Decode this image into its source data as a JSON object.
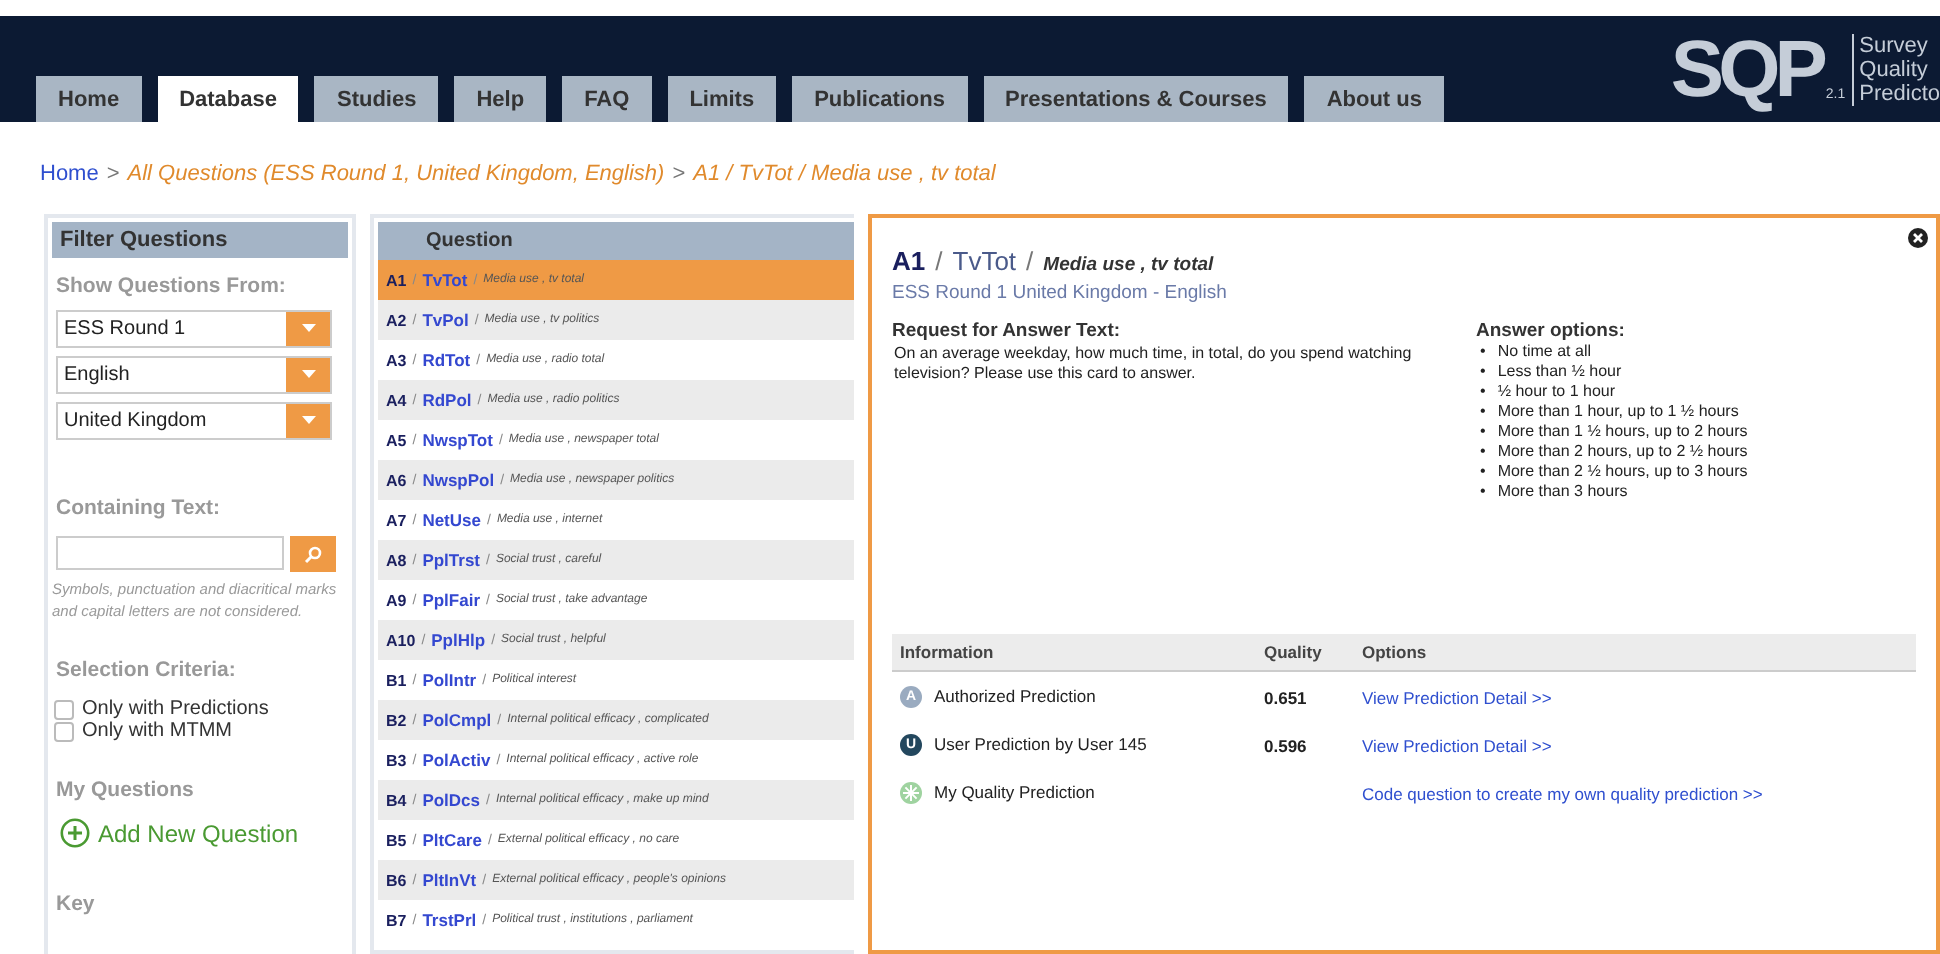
{
  "logo": {
    "mark": "SQP",
    "version": "2.1",
    "lines": [
      "Survey",
      "Quality",
      "Predicto"
    ]
  },
  "tabs": [
    {
      "label": "Home",
      "selected": false
    },
    {
      "label": "Database",
      "selected": true
    },
    {
      "label": "Studies",
      "selected": false
    },
    {
      "label": "Help",
      "selected": false
    },
    {
      "label": "FAQ",
      "selected": false
    },
    {
      "label": "Limits",
      "selected": false
    },
    {
      "label": "Publications",
      "selected": false
    },
    {
      "label": "Presentations & Courses",
      "selected": false
    },
    {
      "label": "About us",
      "selected": false
    }
  ],
  "breadcrumb": [
    {
      "kind": "link",
      "text": "Home"
    },
    {
      "kind": "separator",
      "text": ">"
    },
    {
      "kind": "trail",
      "text": "All Questions (ESS Round 1, United Kingdom, English)"
    },
    {
      "kind": "separator",
      "text": ">"
    },
    {
      "kind": "trail",
      "text": "A1 / TvTot / Media use , tv total"
    }
  ],
  "filter": {
    "title": "Filter Questions",
    "show_from_label": "Show Questions From:",
    "selects": [
      {
        "value": "ESS Round 1"
      },
      {
        "value": "English"
      },
      {
        "value": "United Kingdom"
      }
    ],
    "containing_label": "Containing Text:",
    "search_hint": "Symbols, punctuation and diacritical marks and capital letters are not considered.",
    "criteria_label": "Selection Criteria:",
    "criteria": [
      {
        "label": "Only with Predictions",
        "checked": false
      },
      {
        "label": "Only with MTMM",
        "checked": false
      }
    ],
    "my_questions_label": "My Questions",
    "add_label": "Add New Question",
    "key_label": "Key"
  },
  "questions": {
    "heading": "Question",
    "rows": [
      {
        "code": "A1",
        "variable": "TvTot",
        "description": "Media use , tv total",
        "separators": [
          "/",
          "/"
        ],
        "selected": true
      },
      {
        "code": "A2",
        "variable": "TvPol",
        "description": "Media use , tv politics",
        "separators": [
          "/",
          "/"
        ],
        "selected": false
      },
      {
        "code": "A3",
        "variable": "RdTot",
        "description": "Media use , radio total",
        "separators": [
          "/",
          "/"
        ],
        "selected": false
      },
      {
        "code": "A4",
        "variable": "RdPol",
        "description": "Media use , radio politics",
        "separators": [
          "/",
          "/"
        ],
        "selected": false
      },
      {
        "code": "A5",
        "variable": "NwspTot",
        "description": "Media use , newspaper total",
        "separators": [
          "/",
          "/"
        ],
        "selected": false
      },
      {
        "code": "A6",
        "variable": "NwspPol",
        "description": "Media use , newspaper politics",
        "separators": [
          "/",
          "/"
        ],
        "selected": false
      },
      {
        "code": "A7",
        "variable": "NetUse",
        "description": "Media use , internet",
        "separators": [
          "/",
          "/"
        ],
        "selected": false
      },
      {
        "code": "A8",
        "variable": "PplTrst",
        "description": "Social trust , careful",
        "separators": [
          "/",
          "/"
        ],
        "selected": false
      },
      {
        "code": "A9",
        "variable": "PplFair",
        "description": "Social trust , take advantage",
        "separators": [
          "/",
          "/"
        ],
        "selected": false
      },
      {
        "code": "A10",
        "variable": "PplHlp",
        "description": "Social trust , helpful",
        "separators": [
          "/",
          "/"
        ],
        "selected": false
      },
      {
        "code": "B1",
        "variable": "PolIntr",
        "description": "Political interest",
        "separators": [
          "/",
          "/"
        ],
        "selected": false
      },
      {
        "code": "B2",
        "variable": "PolCmpl",
        "description": "Internal political efficacy , complicated",
        "separators": [
          "/",
          "/"
        ],
        "selected": false
      },
      {
        "code": "B3",
        "variable": "PolActiv",
        "description": "Internal political efficacy , active role",
        "separators": [
          "/",
          "/"
        ],
        "selected": false
      },
      {
        "code": "B4",
        "variable": "PolDcs",
        "description": "Internal political efficacy , make up mind",
        "separators": [
          "/",
          "/"
        ],
        "selected": false
      },
      {
        "code": "B5",
        "variable": "PltCare",
        "description": "External political efficacy , no care",
        "separators": [
          "/",
          "/"
        ],
        "selected": false
      },
      {
        "code": "B6",
        "variable": "PltInVt",
        "description": "External political efficacy , people's opinions",
        "separators": [
          "/",
          "/"
        ],
        "selected": false
      },
      {
        "code": "B7",
        "variable": "TrstPrl",
        "description": "Political trust , institutions , parliament",
        "separators": [
          "/",
          "/"
        ],
        "selected": false
      }
    ]
  },
  "detail": {
    "code": "A1",
    "variable": "TvTot",
    "description": "Media use , tv total",
    "separators": [
      "/",
      "/"
    ],
    "subtitle": "ESS Round 1 United Kingdom - English",
    "request_label": "Request for Answer Text:",
    "request_text": "On an average weekday, how much time, in total, do you spend watching television? Please use this card to answer.",
    "options_label": "Answer options:",
    "options": [
      {
        "bullet": "•",
        "text": "No time at all"
      },
      {
        "bullet": "•",
        "text": "Less than ½ hour"
      },
      {
        "bullet": "•",
        "text": "½ hour to 1 hour"
      },
      {
        "bullet": "•",
        "text": "More than 1 hour, up to 1 ½ hours"
      },
      {
        "bullet": "•",
        "text": "More than 1 ½ hours, up to 2 hours"
      },
      {
        "bullet": "•",
        "text": "More than 2 hours, up to 2 ½ hours"
      },
      {
        "bullet": "•",
        "text": "More than 2 ½ hours, up to 3 hours"
      },
      {
        "bullet": "•",
        "text": "More than 3 hours"
      }
    ],
    "columns": [
      "Information",
      "Quality",
      "Options"
    ],
    "predictions": [
      {
        "kind": "authorized",
        "badge": "A",
        "info": "Authorized Prediction",
        "quality": "0.651",
        "option": "View Prediction Detail >>"
      },
      {
        "kind": "user",
        "badge": "U",
        "info": "User Prediction by User 145",
        "quality": "0.596",
        "option": "View Prediction Detail >>"
      },
      {
        "kind": "mine",
        "info": "My Quality Prediction",
        "option": "Code question to create my own quality prediction >>"
      }
    ]
  }
}
